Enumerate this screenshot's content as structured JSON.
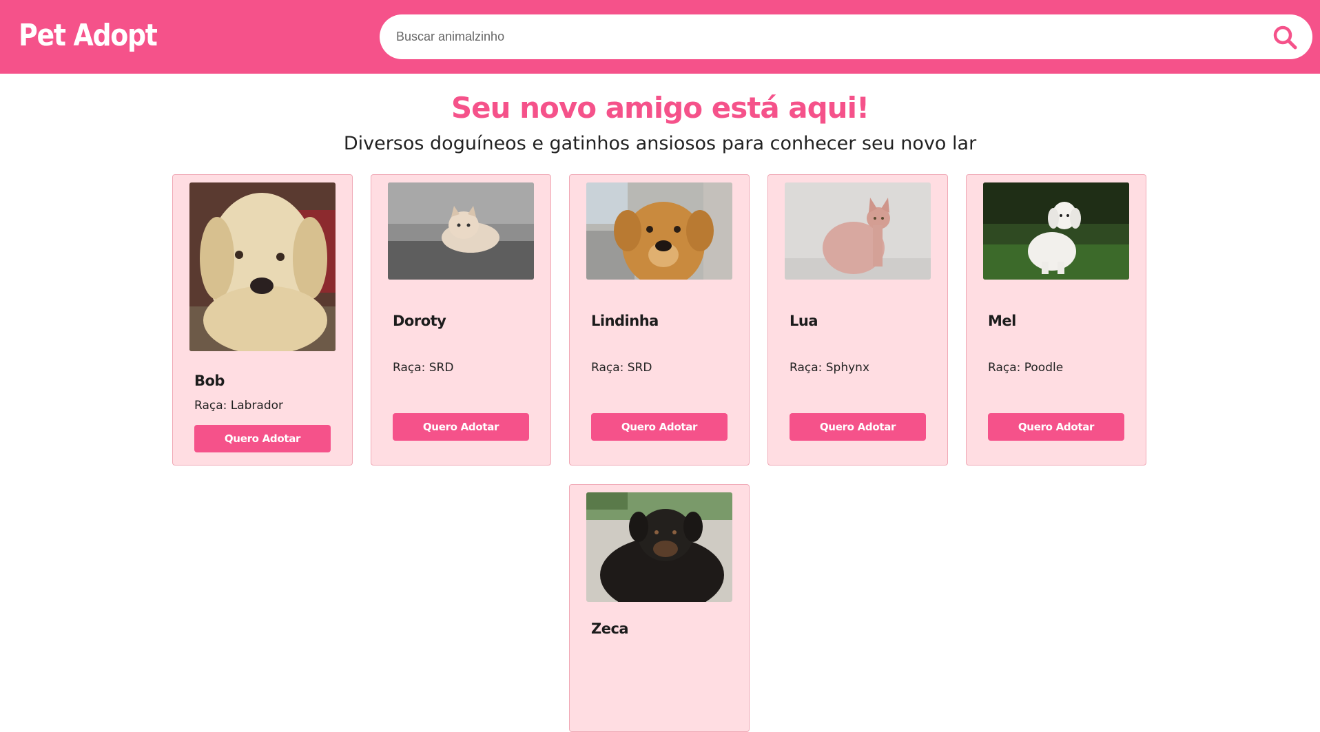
{
  "header": {
    "logo": "Pet Adopt",
    "search_placeholder": "Buscar animalzinho",
    "search_value": ""
  },
  "hero": {
    "title": "Seu novo amigo está aqui!",
    "subtitle": "Diversos doguíneos e gatinhos ansiosos para conhecer seu novo lar"
  },
  "pets": [
    {
      "name": "Bob",
      "breed": "Raça: Labrador",
      "button": "Quero Adotar",
      "photo_icon": "labrador-dog-photo"
    },
    {
      "name": "Doroty",
      "breed": "Raça: SRD",
      "button": "Quero Adotar",
      "photo_icon": "kitten-photo"
    },
    {
      "name": "Lindinha",
      "breed": "Raça: SRD",
      "button": "Quero Adotar",
      "photo_icon": "brown-dog-photo"
    },
    {
      "name": "Lua",
      "breed": "Raça: Sphynx",
      "button": "Quero Adotar",
      "photo_icon": "sphynx-cat-photo"
    },
    {
      "name": "Mel",
      "breed": "Raça: Poodle",
      "button": "Quero Adotar",
      "photo_icon": "poodle-dog-photo"
    },
    {
      "name": "Zeca",
      "photo_icon": "black-dog-photo"
    }
  ],
  "colors": {
    "brand": "#f5528a",
    "card_bg": "#ffdde2",
    "card_border": "#f0a9b6"
  }
}
